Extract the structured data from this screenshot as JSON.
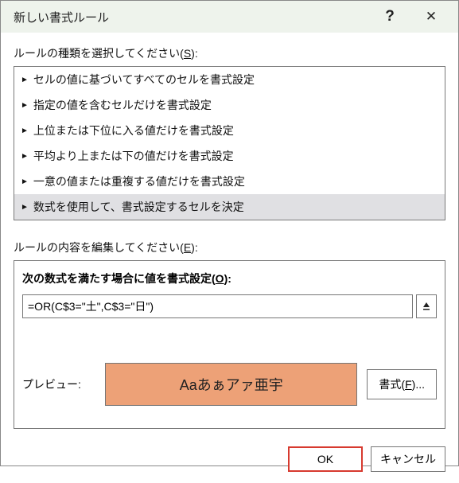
{
  "titlebar": {
    "title": "新しい書式ルール",
    "help": "?",
    "close": "✕"
  },
  "section": {
    "ruleTypeLabel": "ルールの種類を選択してください(S):",
    "ruleTypes": [
      "セルの値に基づいてすべてのセルを書式設定",
      "指定の値を含むセルだけを書式設定",
      "上位または下位に入る値だけを書式設定",
      "平均より上または下の値だけを書式設定",
      "一意の値または重複する値だけを書式設定",
      "数式を使用して、書式設定するセルを決定"
    ],
    "selectedIndex": 5,
    "editLabel": "ルールの内容を編集してください(E):",
    "formulaLabel": "次の数式を満たす場合に値を書式設定(O):",
    "formulaValue": "=OR(C$3=\"土\",C$3=\"日\")",
    "previewLabel": "プレビュー:",
    "previewSample": "Aaあぁアァ亜宇",
    "formatButton": "書式(F)..."
  },
  "footer": {
    "ok": "OK",
    "cancel": "キャンセル"
  }
}
